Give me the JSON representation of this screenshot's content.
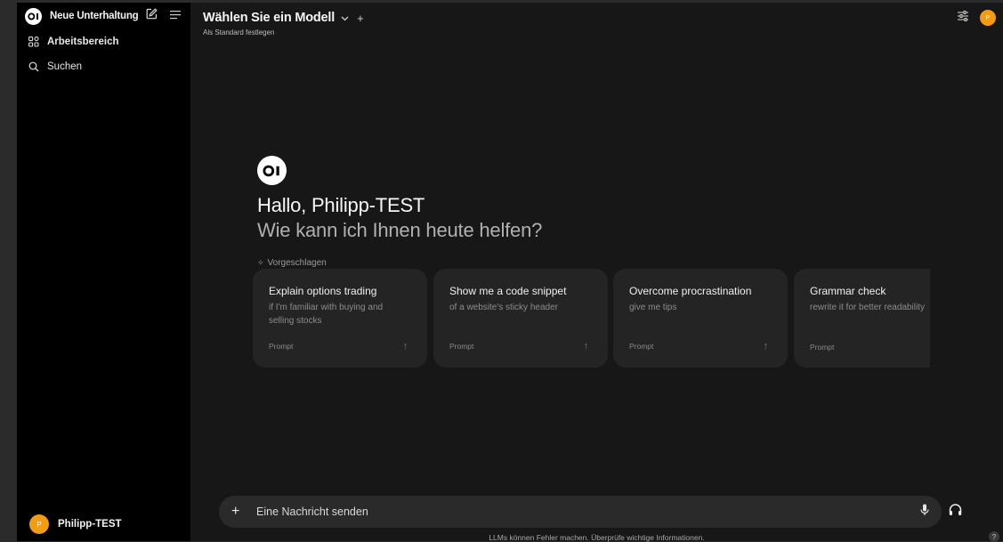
{
  "sidebar": {
    "title": "Neue Unterhaltung",
    "items": [
      {
        "label": "Arbeitsbereich",
        "icon": "workspace-icon"
      },
      {
        "label": "Suchen",
        "icon": "search-icon"
      }
    ],
    "user": {
      "initial": "P",
      "name": "Philipp-TEST"
    }
  },
  "header": {
    "model_selector": "Wählen Sie ein Modell",
    "set_default": "Als Standard festlegen",
    "avatar_initial": "P"
  },
  "logo_text": "OI",
  "welcome": {
    "greeting": "Hallo, Philipp-TEST",
    "question": "Wie kann ich Ihnen heute helfen?",
    "suggested_label": "Vorgeschlagen"
  },
  "suggestions": [
    {
      "title": "Explain options trading",
      "subtitle": "if I'm familiar with buying and selling stocks",
      "footer": "Prompt"
    },
    {
      "title": "Show me a code snippet",
      "subtitle": "of a website's sticky header",
      "footer": "Prompt"
    },
    {
      "title": "Overcome procrastination",
      "subtitle": "give me tips",
      "footer": "Prompt"
    },
    {
      "title": "Grammar check",
      "subtitle": "rewrite it for better readability",
      "footer": "Prompt"
    }
  ],
  "composer": {
    "placeholder": "Eine Nachricht senden"
  },
  "disclaimer": "LLMs können Fehler machen. Überprüfe wichtige Informationen.",
  "help": "?",
  "colors": {
    "accent_avatar": "#f29b13",
    "background": "#171717",
    "sidebar": "#000000",
    "card": "#242424"
  }
}
